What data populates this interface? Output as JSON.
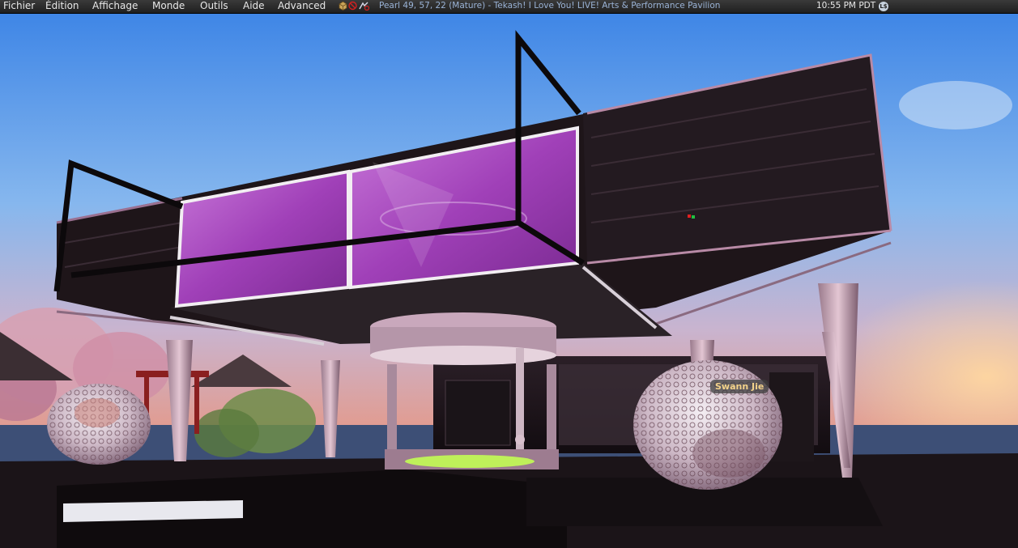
{
  "menu": {
    "items": [
      {
        "label": "Fichier"
      },
      {
        "label": "Édition"
      },
      {
        "label": "Affichage"
      },
      {
        "label": "Monde"
      },
      {
        "label": "Outils"
      },
      {
        "label": "Aide"
      },
      {
        "label": "Advanced"
      }
    ]
  },
  "status_icons": [
    "land-icon",
    "no-fly-icon",
    "no-push-icon"
  ],
  "location": "Pearl 49, 57, 22 (Mature) - Tekash!  I  Love You!  LIVE!  Arts & Performance Pavilion",
  "clock": "10:55 PM PDT",
  "currency_badge": "L$",
  "scene": {
    "avatar_name": "Swann Jie"
  },
  "colors": {
    "accent_purple": "#a040b8",
    "menubar": "#2b2b2b",
    "name_tag": "#f3d28a",
    "location_text": "#9ab3d6"
  }
}
